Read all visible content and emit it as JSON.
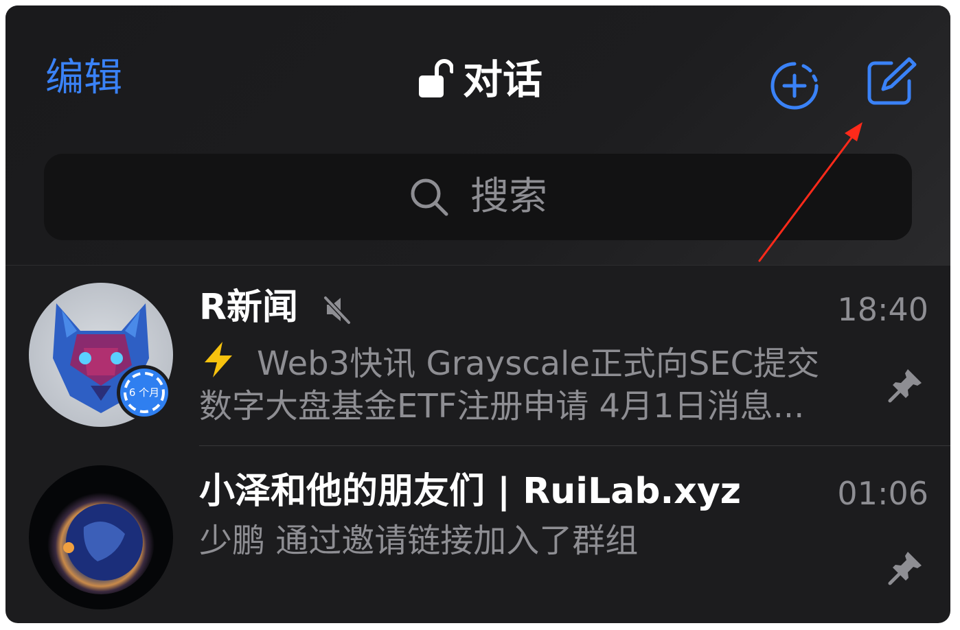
{
  "header": {
    "edit_label": "编辑",
    "title": "对话",
    "lock_icon": "unlocked-padlock-icon",
    "add_story_icon": "add-story-icon",
    "compose_icon": "compose-icon"
  },
  "search": {
    "placeholder": "搜索",
    "icon": "search-icon"
  },
  "chats": [
    {
      "name": "R新闻",
      "muted": true,
      "time": "18:40",
      "preview_emoji": "⚡",
      "preview_line1": "Web3快讯 Grayscale正式向SEC提交",
      "preview_line2": "数字大盘基金ETF注册申请 4月1日消息...",
      "story_badge": "6 个月",
      "pinned": true
    },
    {
      "name": "小泽和他的朋友们 | RuiLab.xyz",
      "muted": false,
      "time": "01:06",
      "preview_line1": "少鹏 通过邀请链接加入了群组",
      "pinned": true
    }
  ],
  "colors": {
    "accent": "#3a82f7",
    "background": "#1c1c1e",
    "annotation_arrow": "#ff2a1a"
  }
}
